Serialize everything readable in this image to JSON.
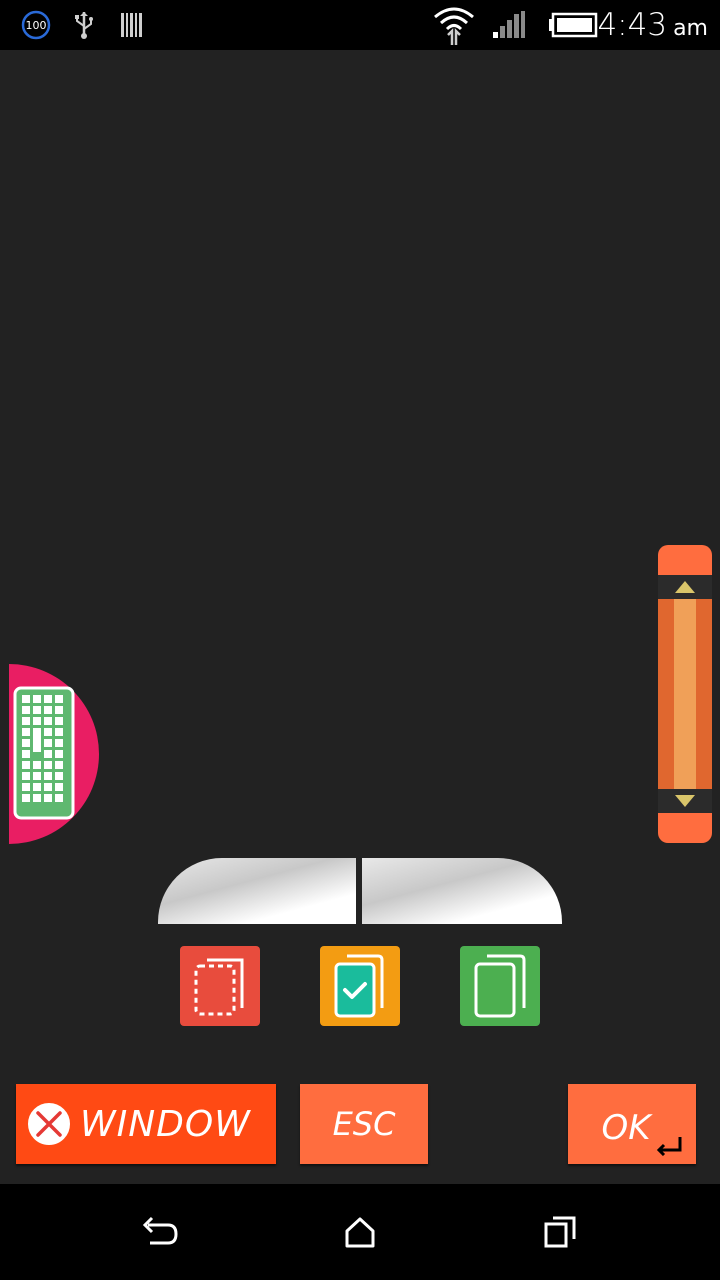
{
  "status_bar": {
    "time": "4:43",
    "ampm": "am",
    "notification_badge": "100",
    "icons": [
      "badge-100-icon",
      "usb-icon",
      "barcode-icon",
      "wifi-icon",
      "signal-icon",
      "battery-icon"
    ]
  },
  "keyboard_toggle": {
    "icon": "keyboard-icon",
    "color": "#e91e63"
  },
  "scroll_bar": {
    "color": "#ff6d3f",
    "up_icon": "arrow-up-icon",
    "down_icon": "arrow-down-icon"
  },
  "mouse": {
    "left_button": "left-click",
    "right_button": "right-click"
  },
  "clipboard": {
    "cut_color": "#e84c3d",
    "paste_color": "#f39c12",
    "copy_color": "#4caf50"
  },
  "actions": {
    "window_label": "WINDOW",
    "esc_label": "ESC",
    "ok_label": "OK"
  },
  "nav_bar": {
    "icons": [
      "back-icon",
      "home-icon",
      "recents-icon"
    ]
  }
}
